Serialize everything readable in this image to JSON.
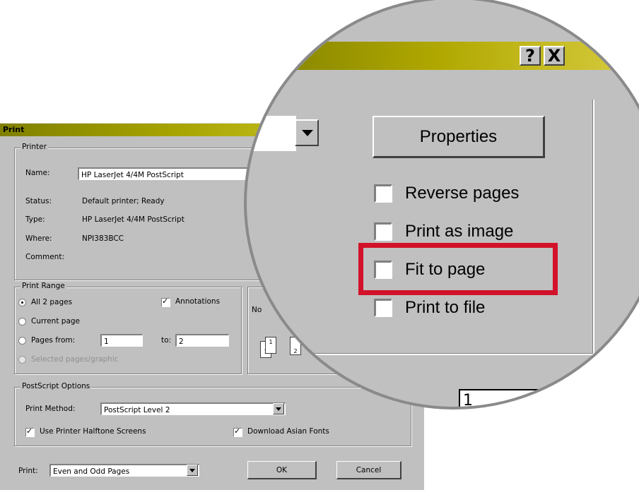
{
  "dialog": {
    "title": "Print",
    "printer_group": {
      "title": "Printer",
      "name_label": "Name:",
      "name_value": "HP LaserJet 4/4M PostScript",
      "status_label": "Status:",
      "status_value": "Default printer; Ready",
      "type_label": "Type:",
      "type_value": "HP LaserJet 4/4M PostScript",
      "where_label": "Where:",
      "where_value": "NPI383BCC",
      "comment_label": "Comment:"
    },
    "print_range": {
      "title": "Print Range",
      "all_pages": "All 2 pages",
      "current_page": "Current page",
      "pages_from": "Pages from:",
      "from_value": "1",
      "to_label": "to:",
      "to_value": "2",
      "selected": "Selected pages/graphic",
      "annotations": "Annotations",
      "copies_label": "No"
    },
    "postscript": {
      "title": "PostScript Options",
      "method_label": "Print Method:",
      "method_value": "PostScript Level 2",
      "halftone": "Use Printer Halftone Screens",
      "asian_fonts": "Download Asian Fonts"
    },
    "footer": {
      "print_label": "Print:",
      "print_value": "Even and Odd Pages",
      "ok": "OK",
      "cancel": "Cancel"
    }
  },
  "magnified": {
    "help_button": "?",
    "close_button": "X",
    "properties_button": "Properties",
    "options": [
      {
        "label": "Reverse pages",
        "checked": false
      },
      {
        "label": "Print as image",
        "checked": false
      },
      {
        "label": "Fit to page",
        "checked": false,
        "highlighted": true
      },
      {
        "label": "Print to file",
        "checked": false
      }
    ],
    "bottom_field_value": "1"
  },
  "colors": {
    "highlight": "#d2122a",
    "dialog_face": "#c0c0c0",
    "titlebar_start": "#808000",
    "titlebar_end": "#ddd14a"
  }
}
